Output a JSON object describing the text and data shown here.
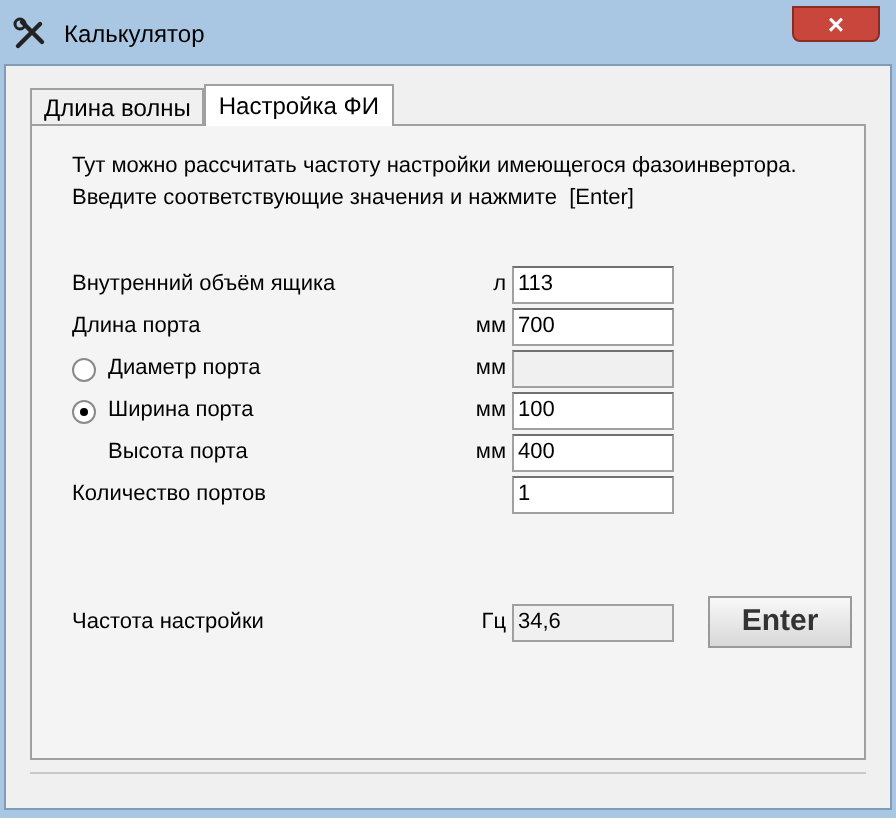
{
  "window": {
    "title": "Калькулятор",
    "close": "×"
  },
  "tabs": [
    {
      "label": "Длина волны",
      "selected": false
    },
    {
      "label": "Настройка ФИ",
      "selected": true
    }
  ],
  "intro": [
    "Тут можно рассчитать частоту настройки имеющегося фазоинвертора.",
    "Введите соответствующие значения и нажмите  [Enter]"
  ],
  "rows": [
    {
      "kind": "plain",
      "label": "Внутренний объём ящика",
      "unit": "л",
      "value": "113",
      "disabled": false
    },
    {
      "kind": "plain",
      "label": "Длина порта",
      "unit": "мм",
      "value": "700",
      "disabled": false
    },
    {
      "kind": "radio",
      "label": "Диаметр порта",
      "unit": "мм",
      "selected": false,
      "disabled": true
    },
    {
      "kind": "radio",
      "label": "Ширина порта",
      "unit": "мм",
      "value": "100",
      "selected": true,
      "disabled": false
    },
    {
      "kind": "indented",
      "label": "Высота порта",
      "unit": "мм",
      "value": "400",
      "disabled": false
    },
    {
      "kind": "plain",
      "label": "Количество портов",
      "value": "1",
      "disabled": false
    }
  ],
  "result": {
    "label": "Частота настройки",
    "unit": "Гц",
    "value": "34,6"
  },
  "enter_button": "Enter"
}
